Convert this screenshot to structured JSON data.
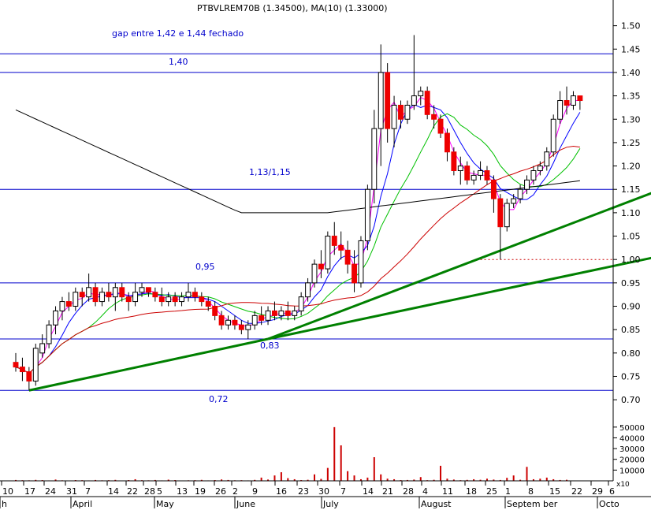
{
  "chart_data": {
    "type": "candlestick",
    "title": "PTBVLREM70B (1.34500), MA(10) (1.33000)",
    "title_color": "#000000",
    "ylim": [
      0.68,
      1.555
    ],
    "y_ticks": [
      0.7,
      0.75,
      0.8,
      0.85,
      0.9,
      0.95,
      1.0,
      1.05,
      1.1,
      1.15,
      1.2,
      1.25,
      1.3,
      1.35,
      1.4,
      1.45,
      1.5
    ],
    "y_tick_labels": [
      "0.70",
      "0.75",
      "0.80",
      "0.85",
      "0.90",
      "0.95",
      "1.00",
      "1.05",
      "1.10",
      "1.15",
      "1.20",
      "1.25",
      "1.30",
      "1.35",
      "1.40",
      "1.45",
      "1.50"
    ],
    "x_day_labels": [
      "10",
      "17",
      "24",
      "31",
      "7",
      "14",
      "22",
      "28",
      "5",
      "13",
      "19",
      "26",
      "2",
      "9",
      "16",
      "23",
      "30",
      "7",
      "14",
      "21",
      "28",
      "4",
      "11",
      "18",
      "25",
      "1",
      "8",
      "15",
      "22",
      "29",
      "6"
    ],
    "month_labels": [
      "h",
      "April",
      "May",
      "June",
      "July",
      "August",
      "Septem ber",
      "Octo"
    ],
    "volume_ticks": [
      "50000",
      "40000",
      "30000",
      "20000",
      "10000"
    ],
    "volume_scale_label": "x10",
    "volume_max": 55000,
    "volume": [
      800,
      600,
      500,
      900,
      700,
      400,
      1200,
      500,
      300,
      700,
      600,
      400,
      800,
      500,
      600,
      900,
      300,
      700,
      1500,
      600,
      500,
      800,
      400,
      1100,
      700,
      300,
      500,
      600,
      900,
      400,
      700,
      1300,
      800,
      500,
      600,
      400,
      900,
      3000,
      1200,
      5000,
      8000,
      2500,
      1500,
      700,
      1000,
      6000,
      1800,
      12000,
      50000,
      33000,
      9000,
      5000,
      1500,
      3000,
      22000,
      6000,
      2000,
      1500,
      700,
      800,
      1200,
      3500,
      600,
      1000,
      14000,
      2000,
      1200,
      600,
      900,
      1500,
      1000,
      2000,
      1200,
      800,
      2800,
      5000,
      1000,
      13000,
      1500,
      2000,
      3000,
      1500,
      800,
      1000
    ],
    "candles": [
      {
        "o": 0.78,
        "h": 0.8,
        "l": 0.76,
        "c": 0.77
      },
      {
        "o": 0.77,
        "h": 0.79,
        "l": 0.74,
        "c": 0.76
      },
      {
        "o": 0.76,
        "h": 0.77,
        "l": 0.72,
        "c": 0.74
      },
      {
        "o": 0.74,
        "h": 0.82,
        "l": 0.73,
        "c": 0.81
      },
      {
        "o": 0.8,
        "h": 0.84,
        "l": 0.79,
        "c": 0.82
      },
      {
        "o": 0.82,
        "h": 0.87,
        "l": 0.81,
        "c": 0.86
      },
      {
        "o": 0.86,
        "h": 0.9,
        "l": 0.84,
        "c": 0.89
      },
      {
        "o": 0.89,
        "h": 0.92,
        "l": 0.87,
        "c": 0.91
      },
      {
        "o": 0.91,
        "h": 0.93,
        "l": 0.89,
        "c": 0.9
      },
      {
        "o": 0.9,
        "h": 0.94,
        "l": 0.89,
        "c": 0.93
      },
      {
        "o": 0.93,
        "h": 0.94,
        "l": 0.9,
        "c": 0.92
      },
      {
        "o": 0.92,
        "h": 0.97,
        "l": 0.91,
        "c": 0.94
      },
      {
        "o": 0.94,
        "h": 0.95,
        "l": 0.9,
        "c": 0.91
      },
      {
        "o": 0.91,
        "h": 0.94,
        "l": 0.9,
        "c": 0.93
      },
      {
        "o": 0.93,
        "h": 0.95,
        "l": 0.91,
        "c": 0.92
      },
      {
        "o": 0.92,
        "h": 0.95,
        "l": 0.89,
        "c": 0.94
      },
      {
        "o": 0.94,
        "h": 0.95,
        "l": 0.91,
        "c": 0.92
      },
      {
        "o": 0.92,
        "h": 0.93,
        "l": 0.89,
        "c": 0.91
      },
      {
        "o": 0.91,
        "h": 0.95,
        "l": 0.9,
        "c": 0.93
      },
      {
        "o": 0.93,
        "h": 0.95,
        "l": 0.92,
        "c": 0.94
      },
      {
        "o": 0.94,
        "h": 0.94,
        "l": 0.92,
        "c": 0.93
      },
      {
        "o": 0.93,
        "h": 0.94,
        "l": 0.91,
        "c": 0.92
      },
      {
        "o": 0.92,
        "h": 0.94,
        "l": 0.9,
        "c": 0.91
      },
      {
        "o": 0.91,
        "h": 0.93,
        "l": 0.9,
        "c": 0.92
      },
      {
        "o": 0.92,
        "h": 0.93,
        "l": 0.9,
        "c": 0.91
      },
      {
        "o": 0.91,
        "h": 0.93,
        "l": 0.9,
        "c": 0.92
      },
      {
        "o": 0.92,
        "h": 0.95,
        "l": 0.91,
        "c": 0.93
      },
      {
        "o": 0.93,
        "h": 0.94,
        "l": 0.91,
        "c": 0.92
      },
      {
        "o": 0.92,
        "h": 0.93,
        "l": 0.9,
        "c": 0.91
      },
      {
        "o": 0.91,
        "h": 0.92,
        "l": 0.89,
        "c": 0.9
      },
      {
        "o": 0.9,
        "h": 0.91,
        "l": 0.87,
        "c": 0.88
      },
      {
        "o": 0.88,
        "h": 0.89,
        "l": 0.85,
        "c": 0.86
      },
      {
        "o": 0.86,
        "h": 0.88,
        "l": 0.85,
        "c": 0.87
      },
      {
        "o": 0.87,
        "h": 0.88,
        "l": 0.85,
        "c": 0.86
      },
      {
        "o": 0.86,
        "h": 0.87,
        "l": 0.84,
        "c": 0.85
      },
      {
        "o": 0.85,
        "h": 0.87,
        "l": 0.83,
        "c": 0.86
      },
      {
        "o": 0.86,
        "h": 0.89,
        "l": 0.85,
        "c": 0.88
      },
      {
        "o": 0.88,
        "h": 0.9,
        "l": 0.86,
        "c": 0.87
      },
      {
        "o": 0.87,
        "h": 0.9,
        "l": 0.86,
        "c": 0.89
      },
      {
        "o": 0.89,
        "h": 0.91,
        "l": 0.87,
        "c": 0.88
      },
      {
        "o": 0.88,
        "h": 0.9,
        "l": 0.87,
        "c": 0.89
      },
      {
        "o": 0.89,
        "h": 0.91,
        "l": 0.87,
        "c": 0.88
      },
      {
        "o": 0.88,
        "h": 0.9,
        "l": 0.87,
        "c": 0.89
      },
      {
        "o": 0.89,
        "h": 0.93,
        "l": 0.88,
        "c": 0.92
      },
      {
        "o": 0.92,
        "h": 0.96,
        "l": 0.91,
        "c": 0.95
      },
      {
        "o": 0.95,
        "h": 1.0,
        "l": 0.94,
        "c": 0.99
      },
      {
        "o": 0.99,
        "h": 1.02,
        "l": 0.96,
        "c": 0.98
      },
      {
        "o": 0.98,
        "h": 1.06,
        "l": 0.97,
        "c": 1.05
      },
      {
        "o": 1.05,
        "h": 1.08,
        "l": 1.01,
        "c": 1.03
      },
      {
        "o": 1.03,
        "h": 1.06,
        "l": 1.0,
        "c": 1.02
      },
      {
        "o": 1.02,
        "h": 1.04,
        "l": 0.97,
        "c": 0.99
      },
      {
        "o": 0.99,
        "h": 1.02,
        "l": 0.93,
        "c": 0.95
      },
      {
        "o": 0.95,
        "h": 1.05,
        "l": 0.94,
        "c": 1.04
      },
      {
        "o": 1.04,
        "h": 1.16,
        "l": 1.02,
        "c": 1.15
      },
      {
        "o": 1.15,
        "h": 1.32,
        "l": 1.12,
        "c": 1.28
      },
      {
        "o": 1.28,
        "h": 1.46,
        "l": 1.2,
        "c": 1.4
      },
      {
        "o": 1.4,
        "h": 1.42,
        "l": 1.25,
        "c": 1.28
      },
      {
        "o": 1.28,
        "h": 1.35,
        "l": 1.24,
        "c": 1.33
      },
      {
        "o": 1.33,
        "h": 1.34,
        "l": 1.28,
        "c": 1.3
      },
      {
        "o": 1.3,
        "h": 1.34,
        "l": 1.29,
        "c": 1.33
      },
      {
        "o": 1.33,
        "h": 1.48,
        "l": 1.32,
        "c": 1.35
      },
      {
        "o": 1.35,
        "h": 1.37,
        "l": 1.33,
        "c": 1.36
      },
      {
        "o": 1.36,
        "h": 1.37,
        "l": 1.3,
        "c": 1.31
      },
      {
        "o": 1.31,
        "h": 1.33,
        "l": 1.28,
        "c": 1.3
      },
      {
        "o": 1.3,
        "h": 1.31,
        "l": 1.26,
        "c": 1.27
      },
      {
        "o": 1.27,
        "h": 1.28,
        "l": 1.21,
        "c": 1.23
      },
      {
        "o": 1.23,
        "h": 1.24,
        "l": 1.18,
        "c": 1.19
      },
      {
        "o": 1.19,
        "h": 1.22,
        "l": 1.16,
        "c": 1.2
      },
      {
        "o": 1.2,
        "h": 1.21,
        "l": 1.16,
        "c": 1.17
      },
      {
        "o": 1.17,
        "h": 1.19,
        "l": 1.16,
        "c": 1.18
      },
      {
        "o": 1.18,
        "h": 1.21,
        "l": 1.17,
        "c": 1.19
      },
      {
        "o": 1.19,
        "h": 1.2,
        "l": 1.16,
        "c": 1.17
      },
      {
        "o": 1.17,
        "h": 1.18,
        "l": 1.1,
        "c": 1.13
      },
      {
        "o": 1.13,
        "h": 1.14,
        "l": 1.0,
        "c": 1.07
      },
      {
        "o": 1.07,
        "h": 1.13,
        "l": 1.06,
        "c": 1.12
      },
      {
        "o": 1.12,
        "h": 1.14,
        "l": 1.11,
        "c": 1.13
      },
      {
        "o": 1.13,
        "h": 1.16,
        "l": 1.12,
        "c": 1.15
      },
      {
        "o": 1.15,
        "h": 1.18,
        "l": 1.14,
        "c": 1.17
      },
      {
        "o": 1.17,
        "h": 1.2,
        "l": 1.16,
        "c": 1.19
      },
      {
        "o": 1.19,
        "h": 1.21,
        "l": 1.18,
        "c": 1.2
      },
      {
        "o": 1.2,
        "h": 1.24,
        "l": 1.19,
        "c": 1.23
      },
      {
        "o": 1.23,
        "h": 1.31,
        "l": 1.22,
        "c": 1.3
      },
      {
        "o": 1.3,
        "h": 1.36,
        "l": 1.29,
        "c": 1.34
      },
      {
        "o": 1.34,
        "h": 1.37,
        "l": 1.31,
        "c": 1.33
      },
      {
        "o": 1.33,
        "h": 1.36,
        "l": 1.32,
        "c": 1.35
      },
      {
        "o": 1.35,
        "h": 1.35,
        "l": 1.32,
        "c": 1.34
      }
    ],
    "h_levels": [
      {
        "value": 1.44,
        "label": "gap entre 1,42 e 1,44 fechado",
        "label_pos": "top-left"
      },
      {
        "value": 1.4,
        "label": "1,40"
      },
      {
        "value": 1.15,
        "label": "1,13/1,15"
      },
      {
        "value": 0.95,
        "label": "0,95"
      },
      {
        "value": 0.83,
        "label": "0,83"
      },
      {
        "value": 0.72,
        "label": "0,72"
      }
    ],
    "trendlines": [
      {
        "from": [
          2,
          0.72
        ],
        "to": [
          38,
          0.83
        ]
      },
      {
        "from": [
          38,
          0.83
        ],
        "to": [
          113,
          1.235
        ]
      },
      {
        "from": [
          38,
          0.83
        ],
        "to": [
          113,
          1.055
        ]
      }
    ],
    "dotted_level": {
      "value": 1.0,
      "from_index": 70
    },
    "colors": {
      "h_level": "#0000cc",
      "trend": "#008000",
      "up": "#ffffff",
      "down": "#ee0000",
      "ma_fast": "#ff00ff",
      "ma_mid": "#0000ff",
      "ma_slow": "#00c000",
      "ma_long": "#cc0000",
      "ma_200": "#000000",
      "label": "#0000cc"
    }
  }
}
